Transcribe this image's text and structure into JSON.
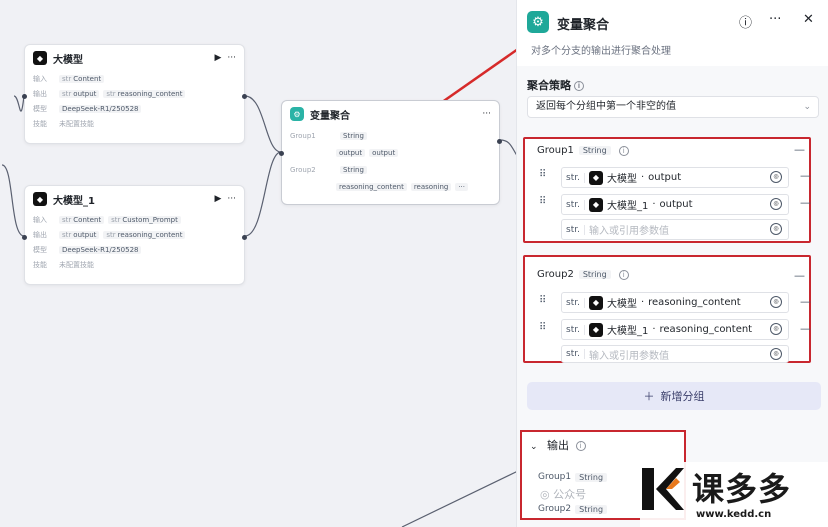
{
  "canvas": {
    "llm1": {
      "title": "大模型",
      "run_icon": "play-icon",
      "more_icon": "more-icon",
      "input_label": "输入",
      "input_items": [
        {
          "type": "str",
          "name": "Content"
        }
      ],
      "output_label": "输出",
      "output_items": [
        {
          "type": "str",
          "name": "output"
        },
        {
          "type": "str",
          "name": "reasoning_content"
        }
      ],
      "model_label": "模型",
      "model_value": "DeepSeek-R1/250528",
      "skill_label": "技能",
      "skill_value": "未配置技能"
    },
    "llm2": {
      "title": "大模型_1",
      "input_label": "输入",
      "input_items": [
        {
          "type": "str",
          "name": "Content"
        },
        {
          "type": "str",
          "name": "Custom_Prompt"
        }
      ],
      "output_label": "输出",
      "output_items": [
        {
          "type": "str",
          "name": "output"
        },
        {
          "type": "str",
          "name": "reasoning_content"
        }
      ],
      "model_label": "模型",
      "model_value": "DeepSeek-R1/250528",
      "skill_label": "技能",
      "skill_value": "未配置技能"
    },
    "agg": {
      "title": "变量聚合",
      "group1_label": "Group1",
      "group1_type": "String",
      "group1_vars": [
        "output",
        "output"
      ],
      "group2_label": "Group2",
      "group2_type": "String",
      "group2_vars": [
        "reasoning_content",
        "reasoning"
      ]
    }
  },
  "panel": {
    "title": "变量聚合",
    "description": "对多个分支的输出进行聚合处理",
    "help_icon": "help-icon",
    "more_icon": "more-icon",
    "close_icon": "close-icon",
    "strategy_label": "聚合策略",
    "strategy_value": "返回每个分组中第一个非空的值",
    "groups": [
      {
        "name": "Group1",
        "type": "String",
        "vars": [
          {
            "type": "str.",
            "node": "大模型",
            "field": "output"
          },
          {
            "type": "str.",
            "node": "大模型_1",
            "field": "output"
          }
        ],
        "placeholder": "输入或引用参数值"
      },
      {
        "name": "Group2",
        "type": "String",
        "vars": [
          {
            "type": "str.",
            "node": "大模型",
            "field": "reasoning_content"
          },
          {
            "type": "str.",
            "node": "大模型_1",
            "field": "reasoning_content"
          }
        ],
        "placeholder": "输入或引用参数值"
      }
    ],
    "add_group_label": "新增分组",
    "output_title": "输出",
    "output_rows": [
      {
        "name": "Group1",
        "type": "String"
      },
      {
        "name": "Group2",
        "type": "String"
      }
    ]
  },
  "overlay": {
    "watermark": "公众号",
    "brand_name": "课多多",
    "brand_url": "www.kedd.cn"
  },
  "colors": {
    "highlight_red": "#c8272f",
    "teal_accent": "#1fa899",
    "add_button_bg": "#e6e8f7"
  }
}
